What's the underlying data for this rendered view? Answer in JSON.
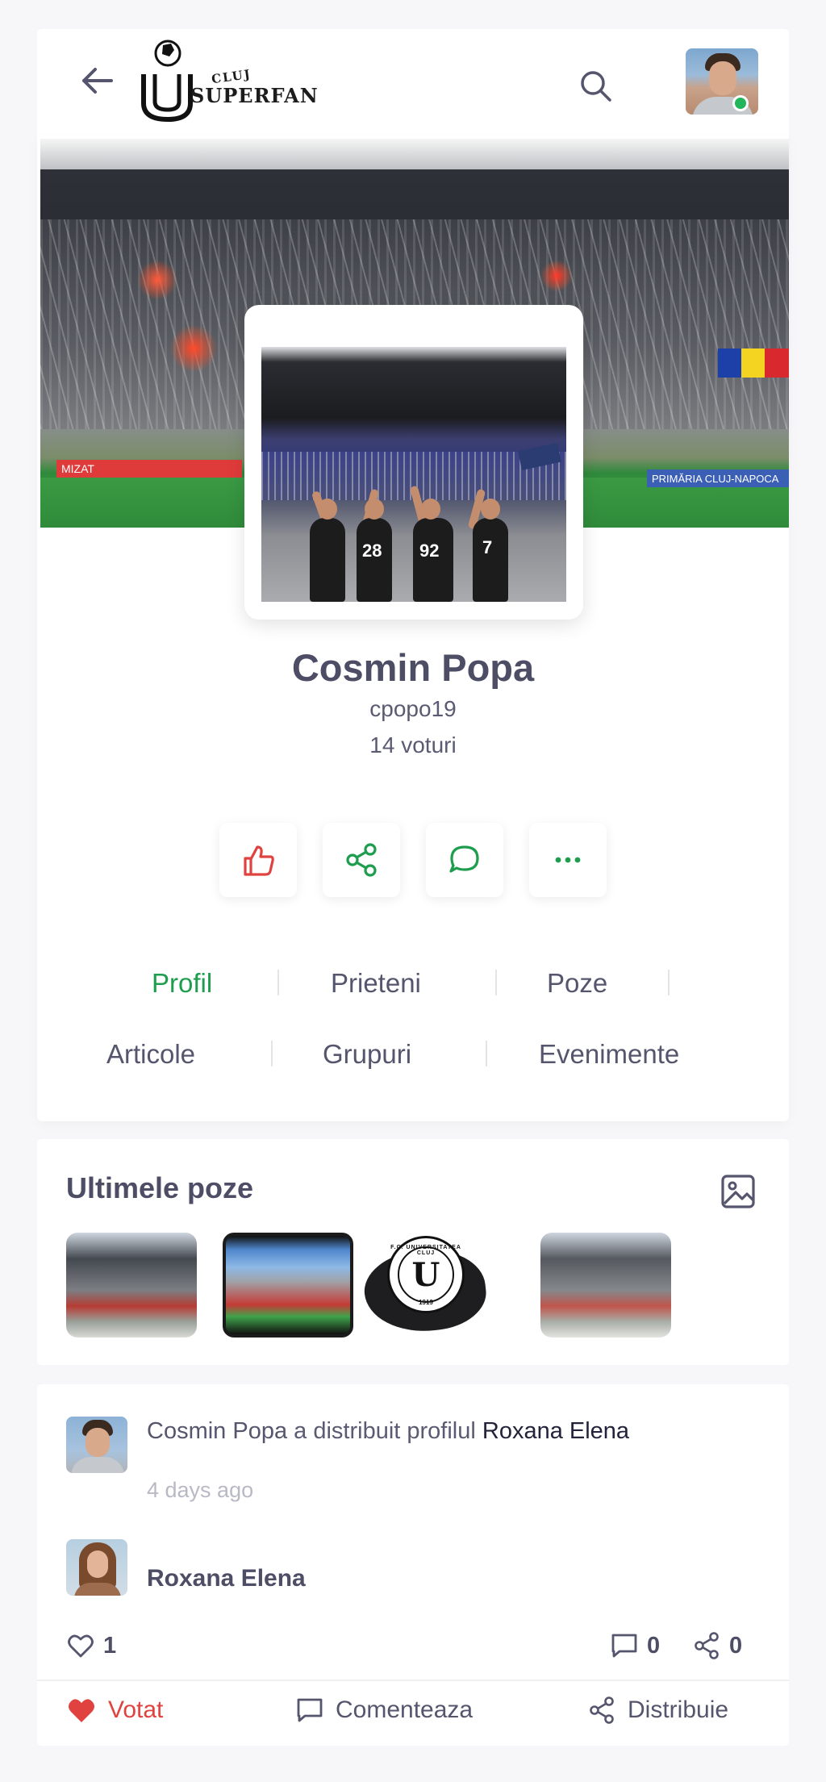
{
  "header": {
    "logo_small": "CLUJ",
    "logo_text": "SUPERFAN"
  },
  "profile": {
    "name": "Cosmin Popa",
    "username": "cpopo19",
    "votes": "14 voturi",
    "cover": {
      "banner_left": "MIZAT",
      "banner_right": "PRIMĂRIA CLUJ-NAPOCA"
    },
    "photo": {
      "numbers": [
        "28",
        "92",
        "7"
      ]
    }
  },
  "actions": {
    "like_icon": "thumbs-up-icon",
    "share_icon": "share-icon",
    "comment_icon": "chat-bubble-icon",
    "more_icon": "more-dots-icon"
  },
  "tabs": [
    {
      "label": "Profil",
      "active": true
    },
    {
      "label": "Prieteni",
      "active": false
    },
    {
      "label": "Poze",
      "active": false
    },
    {
      "label": "Articole",
      "active": false
    },
    {
      "label": "Grupuri",
      "active": false
    },
    {
      "label": "Evenimente",
      "active": false
    }
  ],
  "photos": {
    "title": "Ultimele poze",
    "badge_text": "F.C. UNIVERSITATEA CLUJ",
    "badge_letter": "U",
    "badge_year": "1919"
  },
  "activity": {
    "actor": "Cosmin Popa",
    "verb": "a distribuit profilul",
    "target": "Roxana Elena",
    "time": "4 days ago",
    "shared_profile": "Roxana Elena",
    "likes": "1",
    "comments": "0",
    "shares": "0",
    "vote_label": "Votat",
    "comment_label": "Comenteaza",
    "share_label": "Distribuie"
  },
  "colors": {
    "accent_green": "#1f9d4e",
    "accent_red": "#e0433f",
    "text_dark": "#4d4d66",
    "text_muted": "#b9b9c6"
  }
}
